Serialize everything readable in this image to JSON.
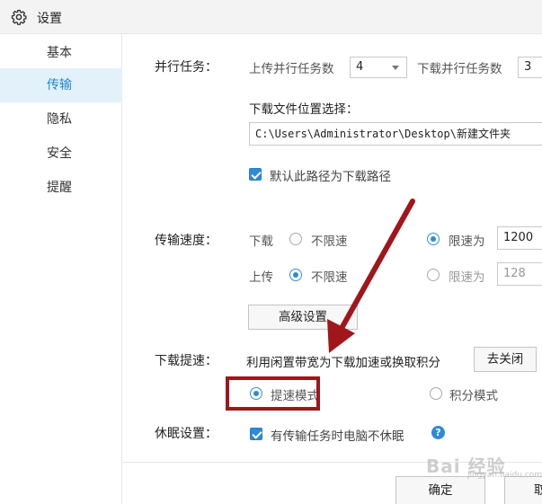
{
  "window": {
    "title": "设置",
    "icon": "gear-icon"
  },
  "sidebar": {
    "items": [
      {
        "label": "基本",
        "active": false
      },
      {
        "label": "传输",
        "active": true
      },
      {
        "label": "隐私",
        "active": false
      },
      {
        "label": "安全",
        "active": false
      },
      {
        "label": "提醒",
        "active": false
      }
    ]
  },
  "parallel": {
    "label": "并行任务：",
    "upload_label": "上传并行任务数",
    "upload_value": "4",
    "download_label": "下载并行任务数",
    "download_value": "3"
  },
  "download_location": {
    "label": "下载文件位置选择：",
    "path": "C:\\Users\\Administrator\\Desktop\\新建文件夹",
    "default_checkbox_label": "默认此路径为下载路径",
    "default_checked": true
  },
  "speed": {
    "label": "传输速度：",
    "download_label": "下载",
    "upload_label": "上传",
    "unlimited_label": "不限速",
    "limit_label": "限速为",
    "download_limit_value": "1200",
    "upload_limit_value": "128",
    "download_mode": "limited",
    "upload_mode": "unlimited",
    "advanced_button": "高级设置"
  },
  "boost": {
    "label": "下载提速：",
    "description": "利用闲置带宽为下载加速或换取积分",
    "close_button": "去关闭",
    "speed_mode_label": "提速模式",
    "points_mode_label": "积分模式",
    "selected": "speed_mode"
  },
  "sleep": {
    "label": "休眠设置：",
    "checkbox_label": "有传输任务时电脑不休眠",
    "checked": true,
    "help_icon": "question-icon",
    "help_glyph": "?"
  },
  "footer": {
    "confirm_button": "确定",
    "cancel_button_partial": "取"
  },
  "annotation": {
    "highlight_color": "#a0161b",
    "arrow_color": "#a0161b"
  },
  "watermark": {
    "text": "Bai 经验",
    "sub": "jingyan.baidu.com"
  },
  "colors": {
    "accent": "#2f8ad8",
    "active_nav_bg": "#e3f1fb"
  }
}
